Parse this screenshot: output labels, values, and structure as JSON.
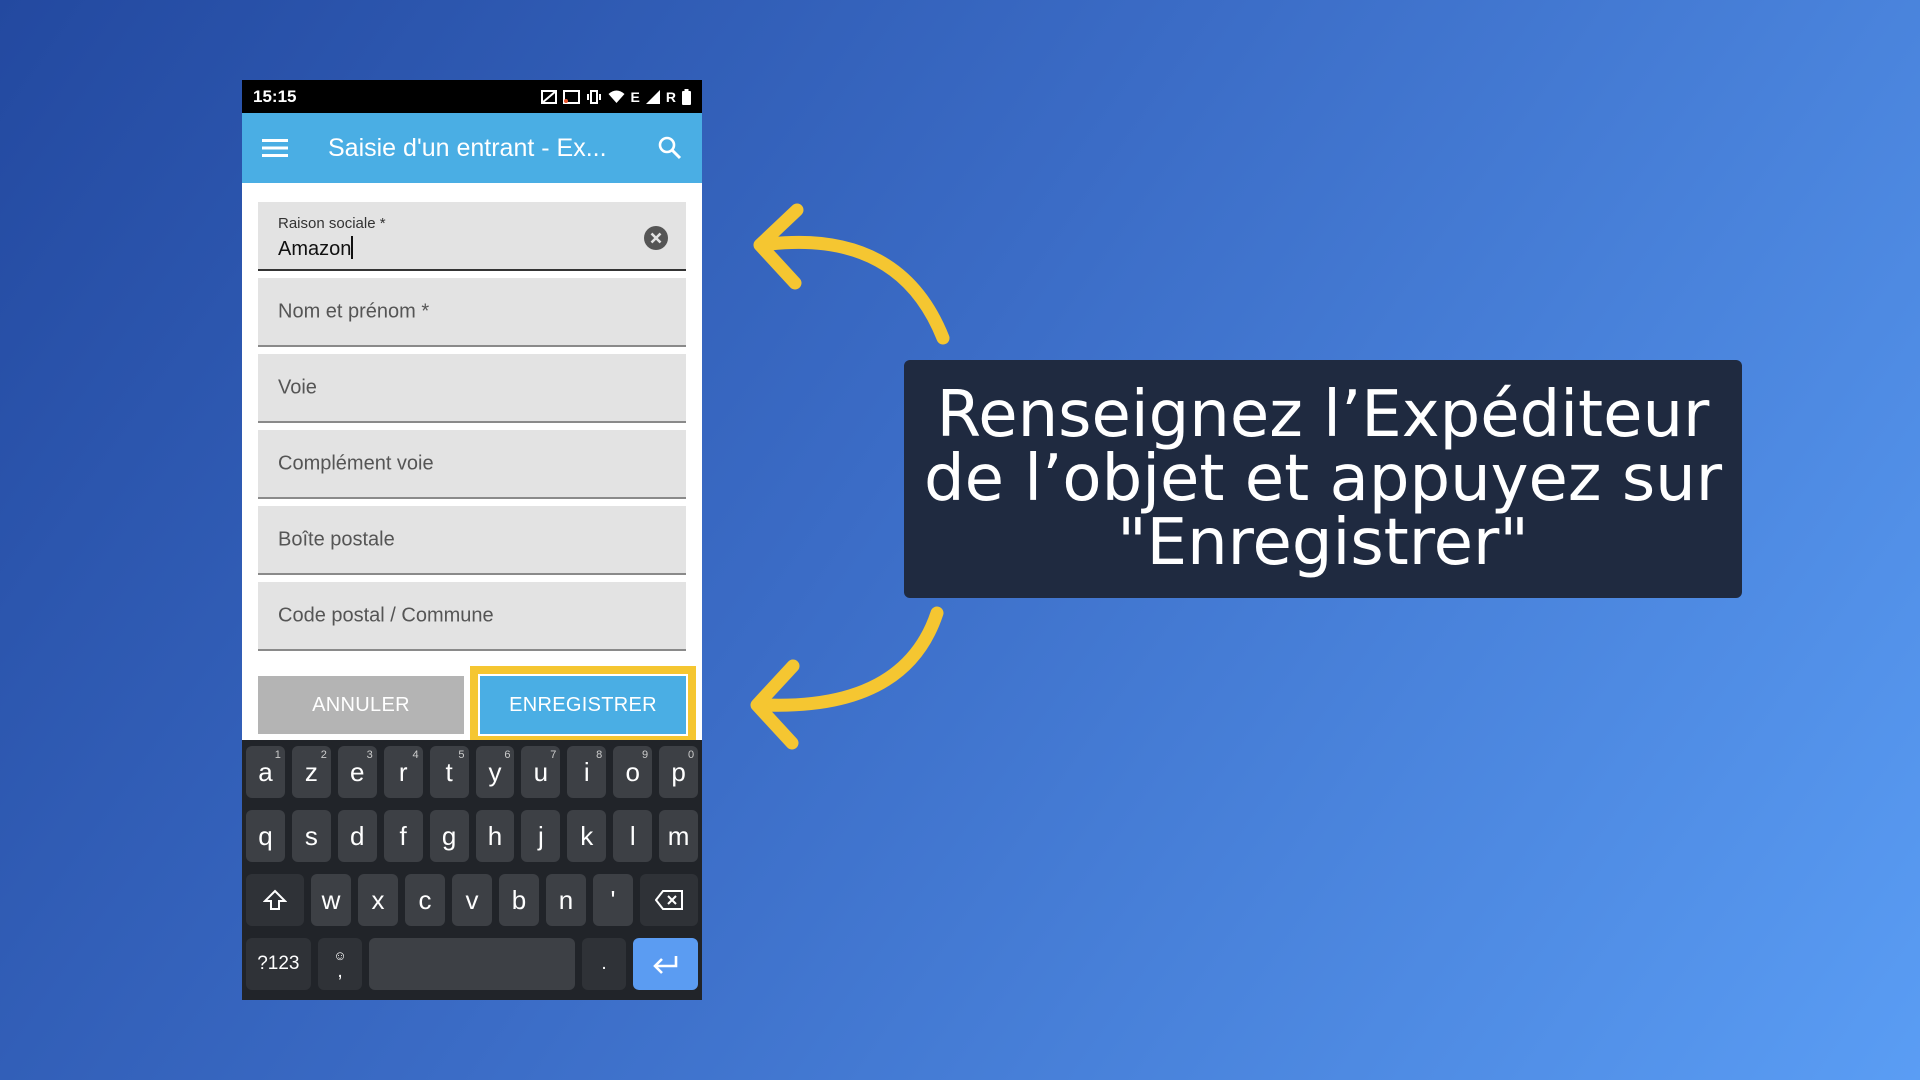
{
  "status_bar": {
    "time": "15:15",
    "network_text": "E",
    "roaming_text": "R"
  },
  "app_bar": {
    "title": "Saisie d'un entrant - Ex..."
  },
  "form": {
    "raison_sociale": {
      "label": "Raison sociale *",
      "value": "Amazon"
    },
    "fields": [
      {
        "placeholder": "Nom et prénom *"
      },
      {
        "placeholder": "Voie"
      },
      {
        "placeholder": "Complément voie"
      },
      {
        "placeholder": "Boîte postale"
      },
      {
        "placeholder": "Code postal / Commune"
      }
    ]
  },
  "buttons": {
    "cancel": "ANNULER",
    "save": "ENREGISTRER"
  },
  "keyboard": {
    "row1": [
      {
        "key": "a",
        "hint": "1"
      },
      {
        "key": "z",
        "hint": "2"
      },
      {
        "key": "e",
        "hint": "3"
      },
      {
        "key": "r",
        "hint": "4"
      },
      {
        "key": "t",
        "hint": "5"
      },
      {
        "key": "y",
        "hint": "6"
      },
      {
        "key": "u",
        "hint": "7"
      },
      {
        "key": "i",
        "hint": "8"
      },
      {
        "key": "o",
        "hint": "9"
      },
      {
        "key": "p",
        "hint": "0"
      }
    ],
    "row2": [
      "q",
      "s",
      "d",
      "f",
      "g",
      "h",
      "j",
      "k",
      "l",
      "m"
    ],
    "row3": [
      "w",
      "x",
      "c",
      "v",
      "b",
      "n",
      "'"
    ],
    "symbols_key": "?123",
    "comma_key": ",",
    "period_key": "."
  },
  "callout": {
    "text": "Renseignez l’Expéditeur de l’objet et appuyez sur \"Enregistrer\""
  },
  "colors": {
    "appbar": "#4aaee4",
    "highlight": "#f5c631",
    "callout_bg": "#1f2a40"
  }
}
